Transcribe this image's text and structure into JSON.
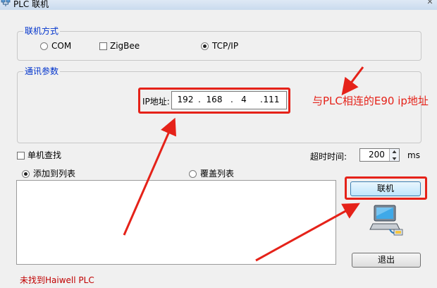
{
  "window": {
    "title": "PLC 联机",
    "close_glyph": "✕"
  },
  "connection_mode": {
    "legend": "联机方式",
    "options": [
      {
        "label": "COM",
        "type": "radio",
        "selected": false
      },
      {
        "label": "ZigBee",
        "type": "checkbox",
        "checked": false
      },
      {
        "label": "TCP/IP",
        "type": "radio",
        "selected": true
      }
    ]
  },
  "comm_params": {
    "legend": "通讯参数",
    "ip_label": "IP地址:",
    "ip": [
      "192",
      "168",
      "4",
      "111"
    ],
    "ip_separator": "."
  },
  "single_search": {
    "label": "单机查找",
    "checked": false
  },
  "timeout": {
    "label": "超时时间:",
    "value": "200",
    "unit": "ms"
  },
  "list_mode": {
    "add": {
      "label": "添加到列表",
      "selected": true
    },
    "overwrite": {
      "label": "覆盖列表",
      "selected": false
    }
  },
  "buttons": {
    "connect": "联机",
    "exit": "退出"
  },
  "status": {
    "text": "未找到Haiwell PLC",
    "color": "#c00000"
  },
  "annotation": {
    "text": "与PLC相连的E90 ip地址",
    "color": "#e52219"
  },
  "icons": {
    "title": "network-icon",
    "computer": "computer-connection-icon"
  }
}
